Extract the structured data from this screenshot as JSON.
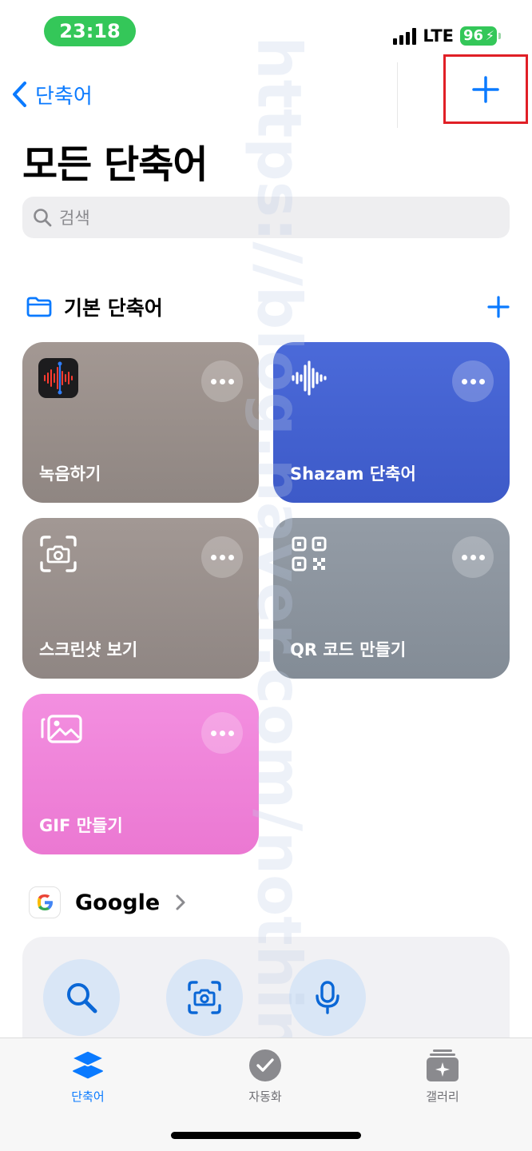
{
  "status_bar": {
    "time": "23:18",
    "network": "LTE",
    "battery": "96"
  },
  "nav": {
    "back_label": "단축어",
    "add_icon": "plus-icon"
  },
  "page_title": "모든 단축어",
  "search": {
    "placeholder": "검색"
  },
  "section": {
    "title": "기본 단축어"
  },
  "shortcuts": [
    {
      "label": "녹음하기",
      "icon": "voice-memos-icon"
    },
    {
      "label": "Shazam 단축어",
      "icon": "shazam-wave-icon"
    },
    {
      "label": "스크린샷 보기",
      "icon": "screenshot-camera-icon"
    },
    {
      "label": "QR 코드 만들기",
      "icon": "qr-code-icon"
    },
    {
      "label": "GIF 만들기",
      "icon": "photos-stack-icon"
    }
  ],
  "app_section": {
    "title": "Google"
  },
  "google_actions": [
    "search-icon",
    "lens-camera-icon",
    "microphone-icon"
  ],
  "tabs": [
    {
      "label": "단축어",
      "icon": "layers-icon",
      "active": true
    },
    {
      "label": "자동화",
      "icon": "check-clock-icon",
      "active": false
    },
    {
      "label": "갤러리",
      "icon": "gallery-sparkle-icon",
      "active": false
    }
  ],
  "watermark": "https://blog.naver.com/nothink__",
  "colors": {
    "accent": "#0a7aff",
    "highlight_border": "#e01f26",
    "battery": "#34c759"
  }
}
